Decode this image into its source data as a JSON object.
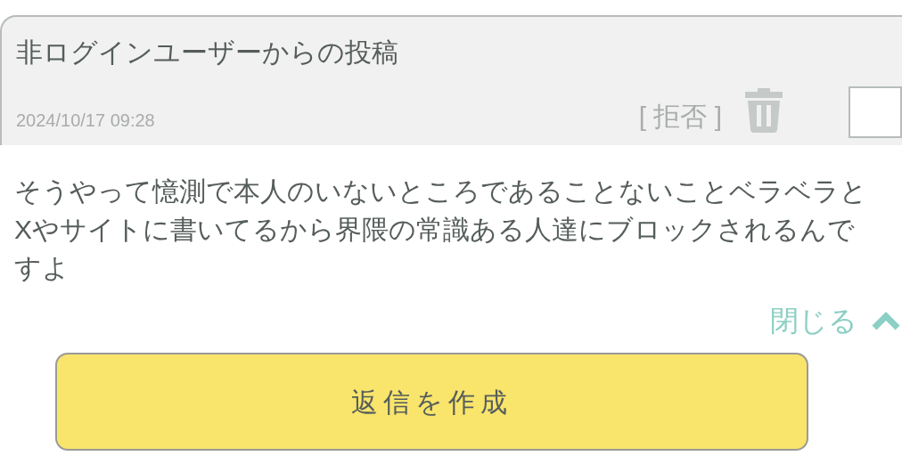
{
  "post": {
    "title": "非ログインユーザーからの投稿",
    "date": "2024/10/17 09:28",
    "reject": "[ 拒否 ]",
    "checked": false,
    "body": "そうやって憶測で本人のいないところであることないことベラベラとXやサイトに書いてるから界隈の常識ある人達にブロックされるんですよ",
    "toggle": "閉じる",
    "expanded": true
  },
  "reply_button": "返信を作成"
}
